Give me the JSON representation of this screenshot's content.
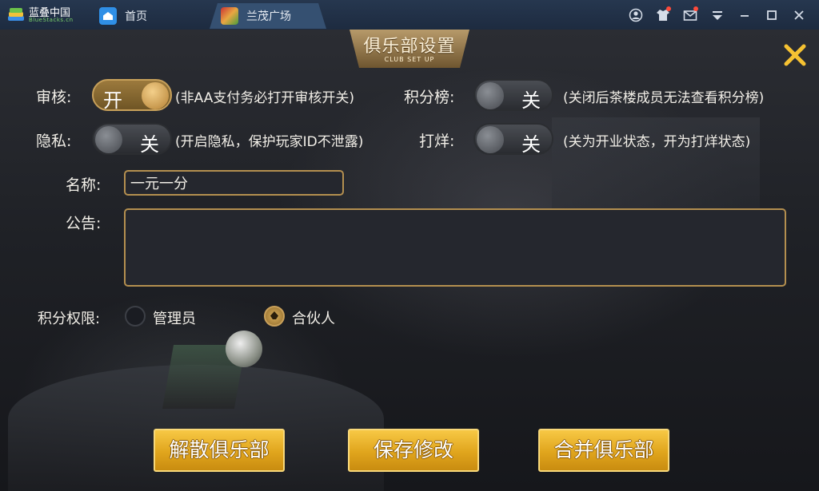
{
  "titlebar": {
    "logo_text": "蓝叠中国",
    "logo_sub": "BlueStacks.cn",
    "tabs": [
      {
        "label": "首页",
        "icon": "home-icon"
      },
      {
        "label": "兰茂广场",
        "icon": "game-app-icon"
      }
    ],
    "window_icons": [
      "account-icon",
      "shirt-icon",
      "mail-icon",
      "menu-down-icon",
      "minimize-icon",
      "maximize-icon",
      "close-icon"
    ]
  },
  "dialog": {
    "title": "俱乐部设置",
    "subtitle": "CLUB SET UP",
    "close_icon": "close-x-icon",
    "review": {
      "label": "审核:",
      "state": "开",
      "on": true,
      "hint": "(非AA支付务必打开审核开关)"
    },
    "leaderboard": {
      "label": "积分榜:",
      "state": "关",
      "on": false,
      "hint": "(关闭后茶楼成员无法查看积分榜)"
    },
    "privacy": {
      "label": "隐私:",
      "state": "关",
      "on": false,
      "hint": "(开启隐私，保护玩家ID不泄露)"
    },
    "closing": {
      "label": "打烊:",
      "state": "关",
      "on": false,
      "hint": "(关为开业状态，开为打烊状态)"
    },
    "name": {
      "label": "名称:",
      "value": "一元一分"
    },
    "notice": {
      "label": "公告:",
      "value": ""
    },
    "score_permission": {
      "label": "积分权限:",
      "options": [
        {
          "label": "管理员",
          "selected": false
        },
        {
          "label": "合伙人",
          "selected": true
        }
      ]
    },
    "buttons": {
      "dissolve": "解散俱乐部",
      "save": "保存修改",
      "merge": "合并俱乐部"
    }
  },
  "colors": {
    "accent_gold": "#e0a51d",
    "toggle_on": "#9c7a3d",
    "titlebar": "#26374f"
  }
}
